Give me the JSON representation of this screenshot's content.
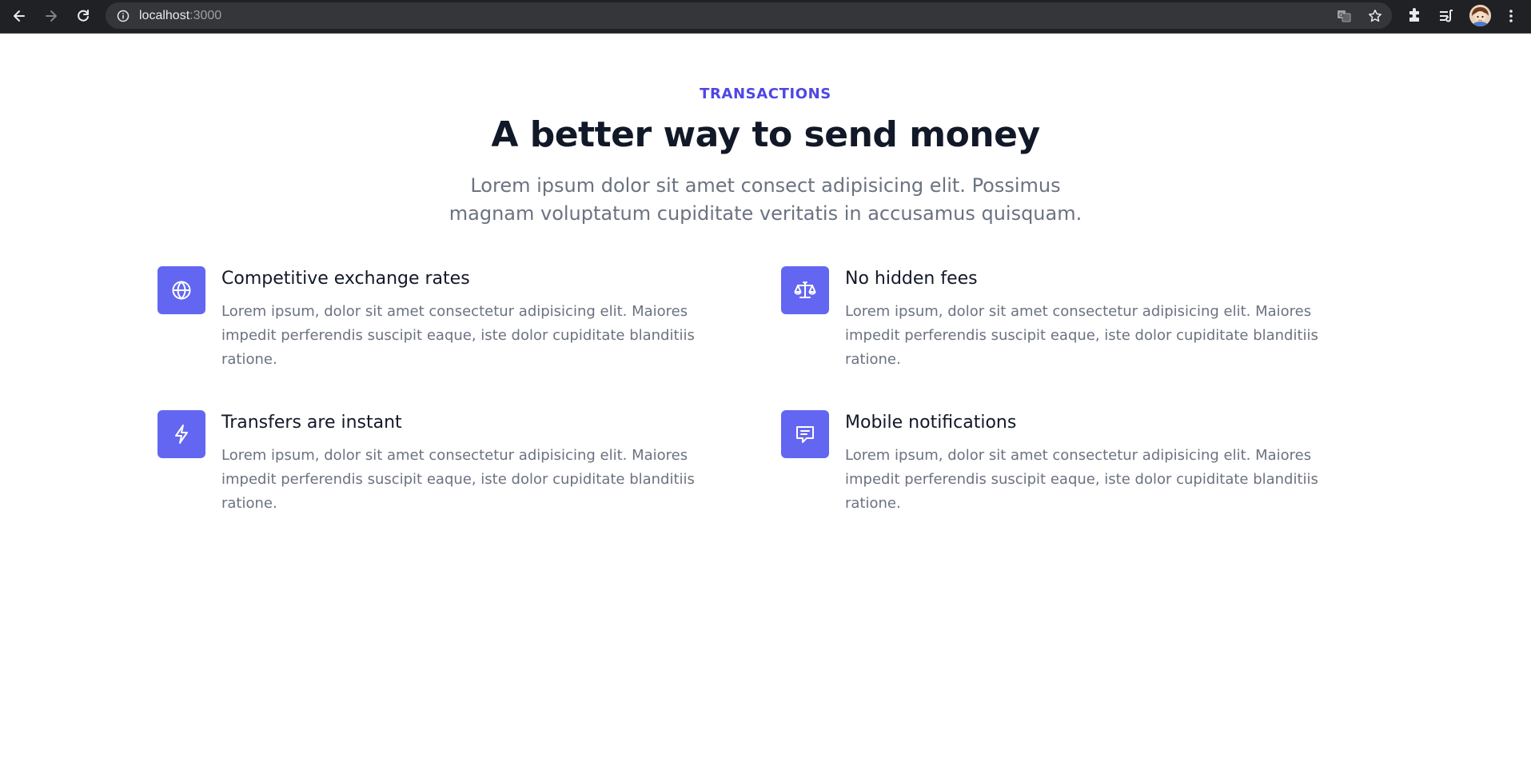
{
  "browser": {
    "url_host": "localhost",
    "url_port": ":3000",
    "icons": {
      "back": "arrow-left-icon",
      "forward": "arrow-right-icon",
      "reload": "reload-icon",
      "site_info": "info-icon",
      "translate": "translate-icon",
      "bookmark": "star-icon",
      "extensions": "puzzle-icon",
      "reading_list": "reading-list-icon",
      "profile": "avatar",
      "menu": "kebab-menu-icon"
    }
  },
  "section": {
    "eyebrow": "TRANSACTIONS",
    "headline": "A better way to send money",
    "lead": "Lorem ipsum dolor sit amet consect adipisicing elit. Possimus magnam voluptatum cupiditate veritatis in accusamus quisquam."
  },
  "features": [
    {
      "title": "Competitive exchange rates",
      "description": "Lorem ipsum, dolor sit amet consectetur adipisicing elit. Maiores impedit perferendis suscipit eaque, iste dolor cupiditate blanditiis ratione.",
      "icon": "globe-icon"
    },
    {
      "title": "No hidden fees",
      "description": "Lorem ipsum, dolor sit amet consectetur adipisicing elit. Maiores impedit perferendis suscipit eaque, iste dolor cupiditate blanditiis ratione.",
      "icon": "scale-icon"
    },
    {
      "title": "Transfers are instant",
      "description": "Lorem ipsum, dolor sit amet consectetur adipisicing elit. Maiores impedit perferendis suscipit eaque, iste dolor cupiditate blanditiis ratione.",
      "icon": "lightning-bolt-icon"
    },
    {
      "title": "Mobile notifications",
      "description": "Lorem ipsum, dolor sit amet consectetur adipisicing elit. Maiores impedit perferendis suscipit eaque, iste dolor cupiditate blanditiis ratione.",
      "icon": "chat-message-icon"
    }
  ],
  "colors": {
    "accent": "#4f46e5",
    "icon_bg": "#6366f1",
    "heading": "#111827",
    "body_text": "#6b7280",
    "chrome_bg": "#202124"
  }
}
